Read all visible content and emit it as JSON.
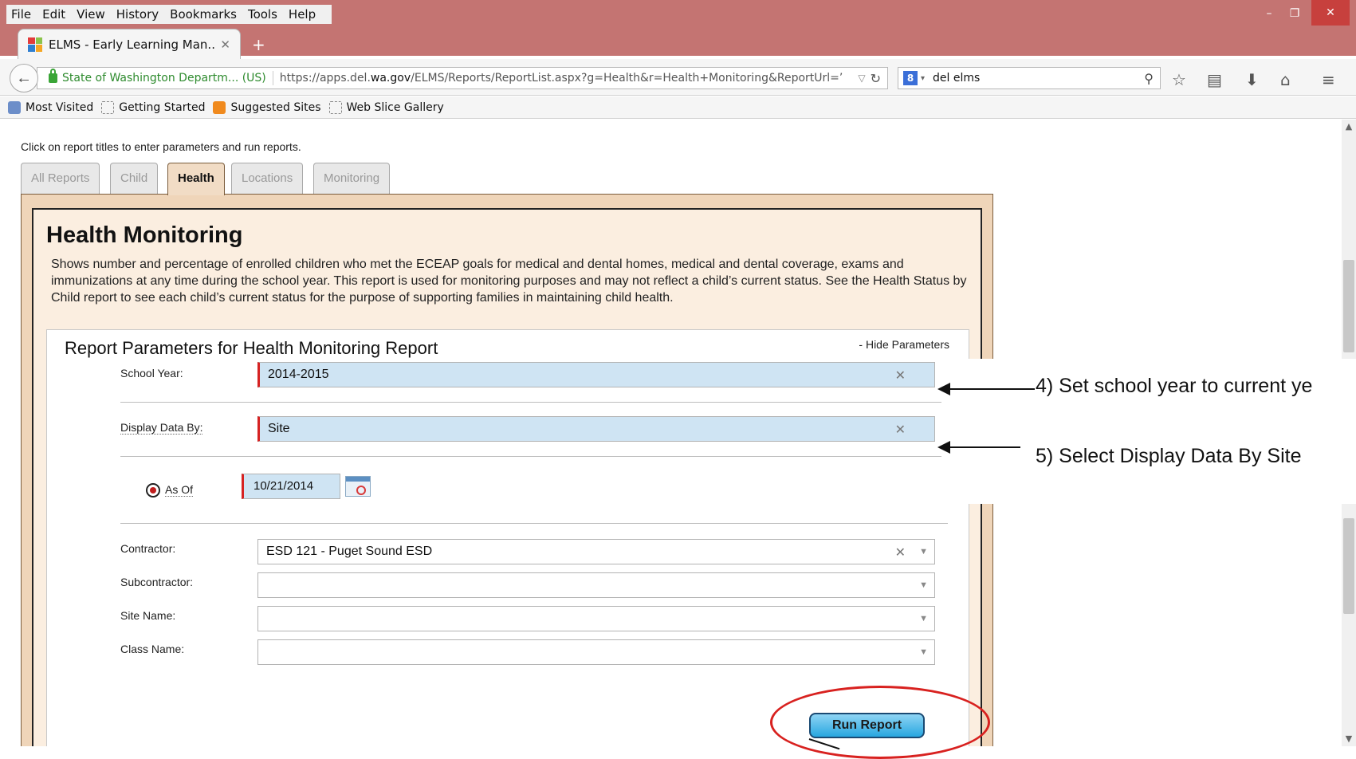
{
  "browser": {
    "menu": [
      "File",
      "Edit",
      "View",
      "History",
      "Bookmarks",
      "Tools",
      "Help"
    ],
    "tab_title": "ELMS - Early Learning Man...",
    "identity": "State of Washington Departm... (US)",
    "url_prefix": "https://apps.del.",
    "url_domain": "wa.gov",
    "url_suffix": "/ELMS/Reports/ReportList.aspx?g=Health&r=Health+Monitoring&ReportUrl=’",
    "search_value": "del elms",
    "bookmarks": [
      "Most Visited",
      "Getting Started",
      "Suggested Sites",
      "Web Slice Gallery"
    ]
  },
  "page": {
    "instructions": "Click on report titles to enter parameters and run reports.",
    "tabs": [
      "All Reports",
      "Child",
      "Health",
      "Locations",
      "Monitoring"
    ],
    "active_tab": "Health",
    "report": {
      "title": "Health Monitoring",
      "description": "Shows number and percentage of enrolled children who met the ECEAP goals for medical and dental homes, medical and dental coverage, exams and immunizations at any time during the school year. This report is used for monitoring purposes and may not reflect a child’s current status. See the Health Status by Child report to see each child’s current status for the purpose of supporting families in maintaining child health."
    },
    "params": {
      "title": "Report Parameters for Health Monitoring Report",
      "hide_link": "- Hide Parameters",
      "school_year_label": "School Year:",
      "school_year_value": "2014-2015",
      "display_by_label": "Display Data By:",
      "display_by_value": "Site",
      "as_of_label": "As Of",
      "as_of_value": "10/21/2014",
      "contractor_label": "Contractor:",
      "contractor_value": "ESD 121 - Puget Sound ESD",
      "subcontractor_label": "Subcontractor:",
      "subcontractor_value": "",
      "site_name_label": "Site Name:",
      "site_name_value": "",
      "class_name_label": "Class Name:",
      "class_name_value": "",
      "run_button": "Run Report"
    }
  },
  "annotations": {
    "step4": "4) Set school year to current ye",
    "step5": "5) Select Display Data By Site"
  }
}
